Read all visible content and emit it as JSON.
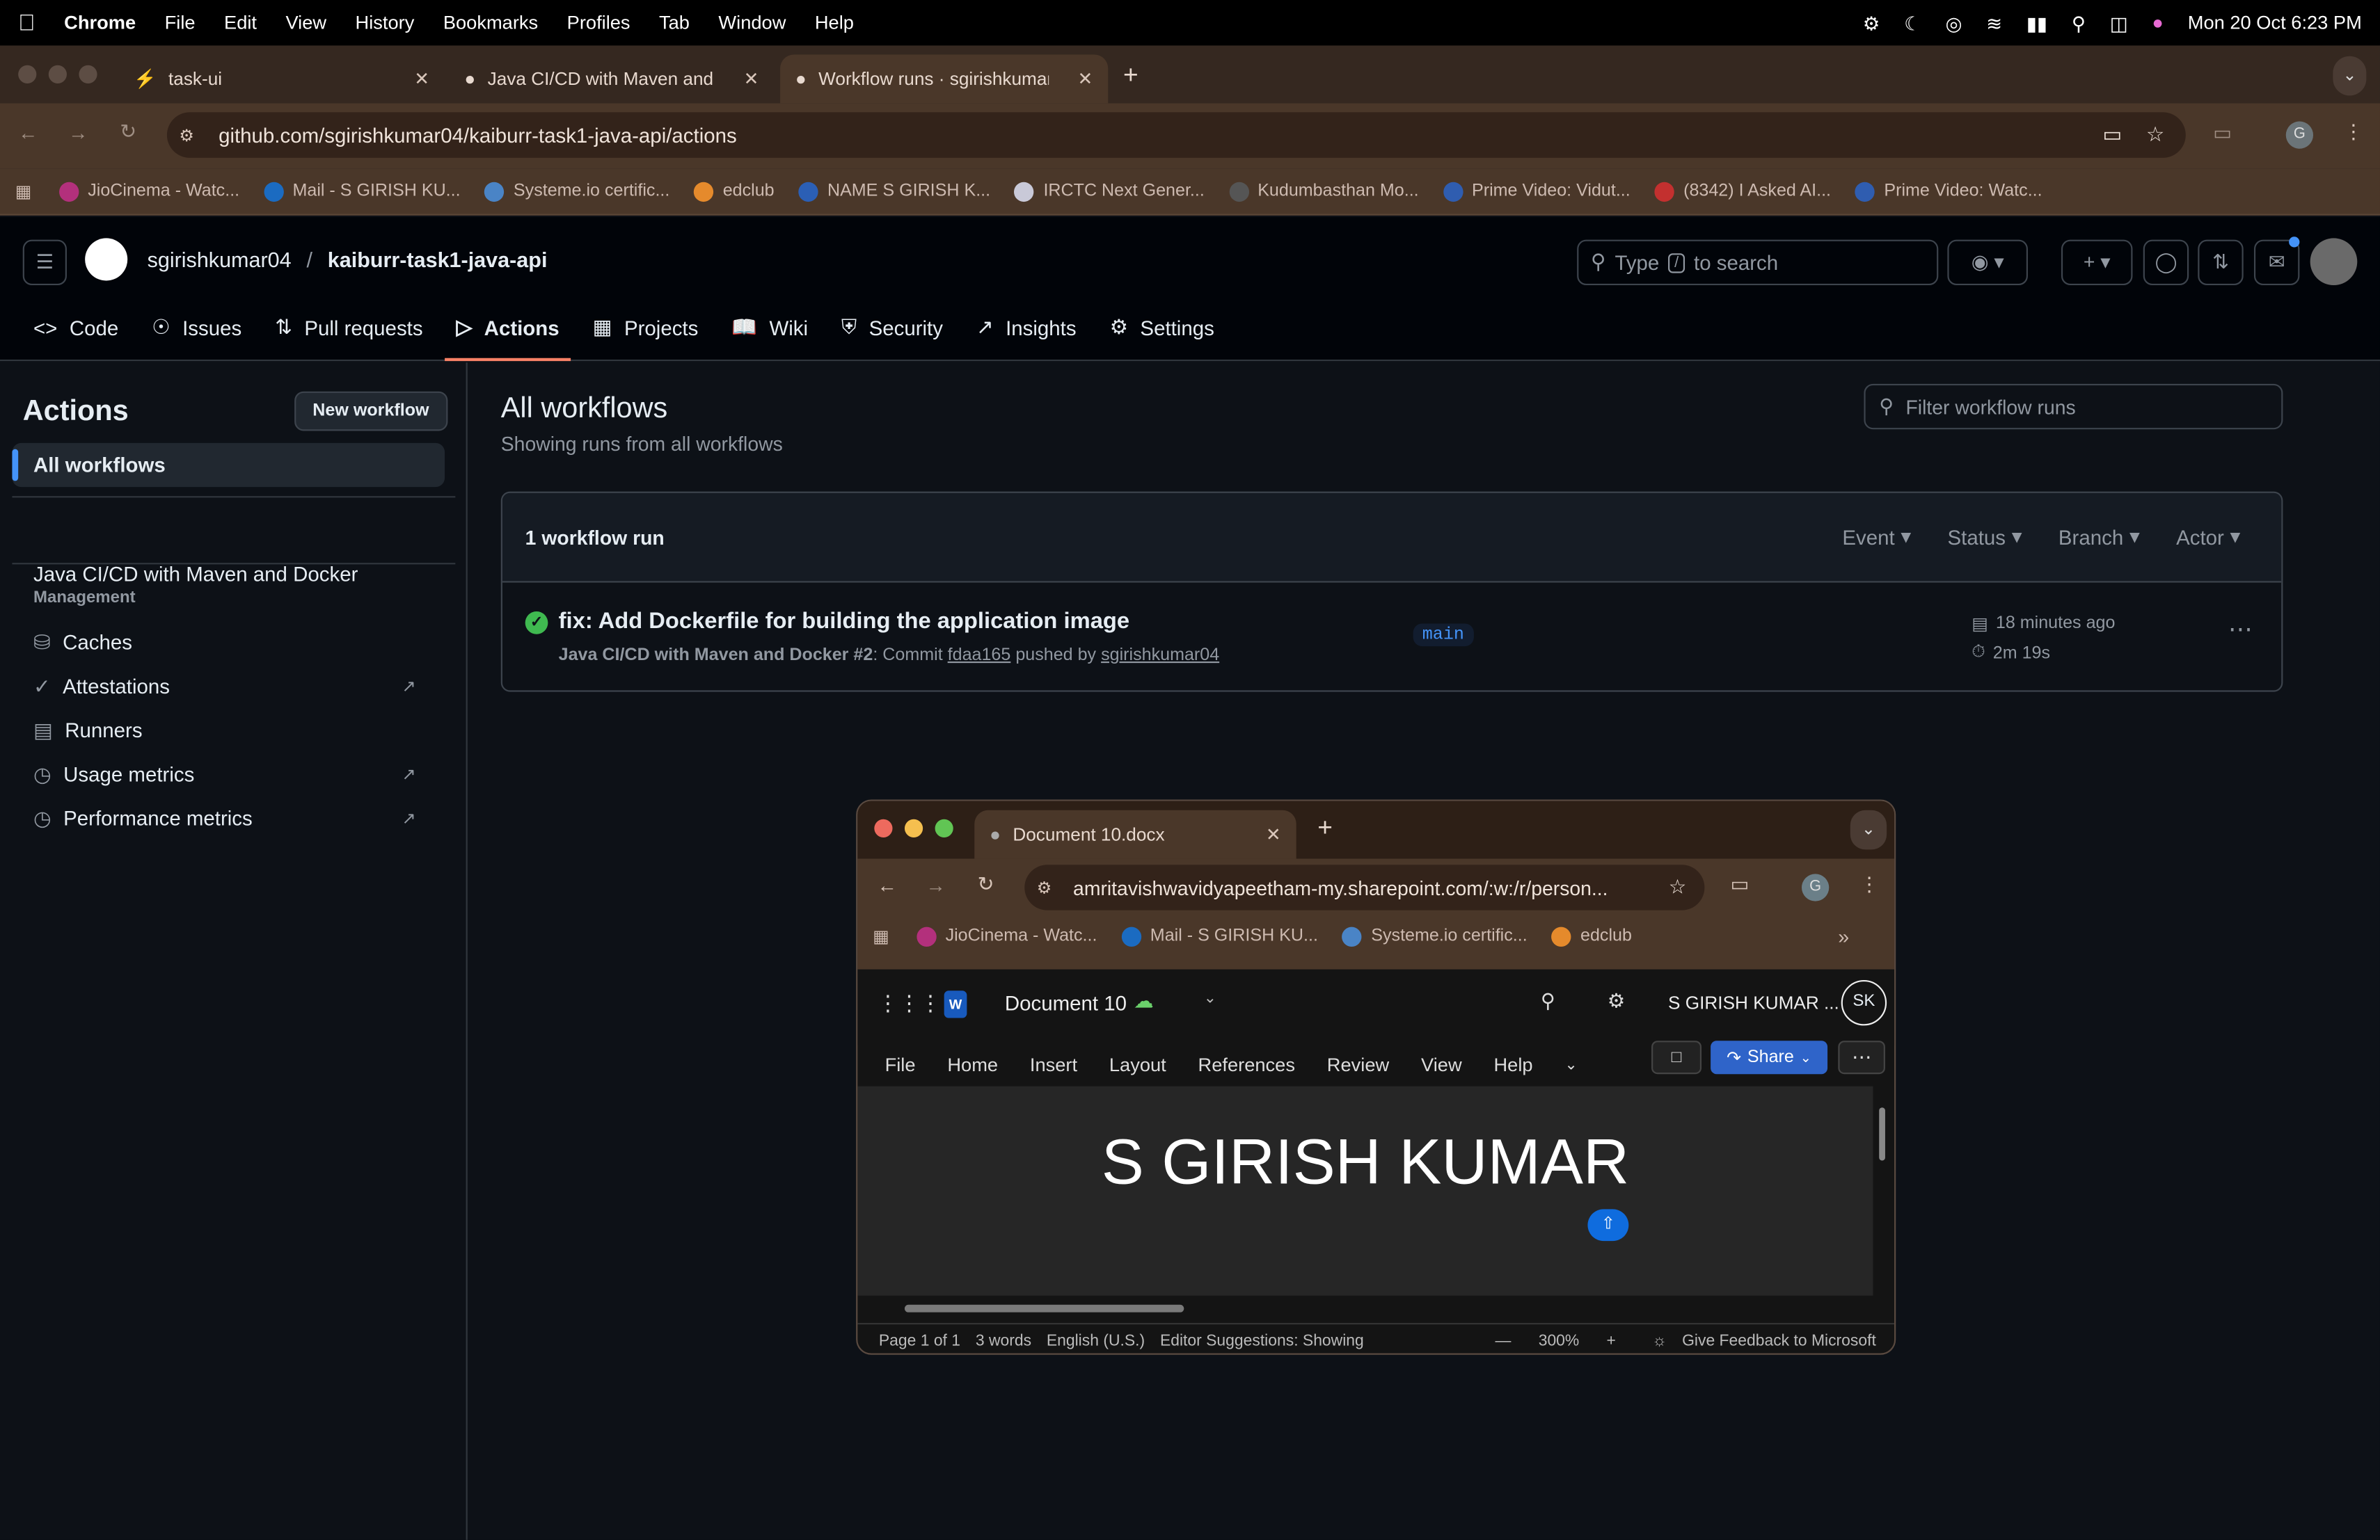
{
  "menubar": {
    "app": "Chrome",
    "items": [
      "File",
      "Edit",
      "View",
      "History",
      "Bookmarks",
      "Profiles",
      "Tab",
      "Window",
      "Help"
    ],
    "clock": "Mon 20 Oct  6:23 PM"
  },
  "tabs": [
    {
      "title": "task-ui"
    },
    {
      "title": "Java CI/CD with Maven and D"
    },
    {
      "title": "Workflow runs · sgirishkumar("
    }
  ],
  "address": "github.com/sgirishkumar04/kaiburr-task1-java-api/actions",
  "profile_initial": "G",
  "bookmarks": [
    {
      "label": "JioCinema - Watc...",
      "color": "#b3307c"
    },
    {
      "label": "Mail - S GIRISH KU...",
      "color": "#1b6bc1"
    },
    {
      "label": "Systeme.io certific...",
      "color": "#4a84c6"
    },
    {
      "label": "edclub",
      "color": "#e58a2c"
    },
    {
      "label": "NAME S GIRISH K...",
      "color": "#2b5fb5"
    },
    {
      "label": "IRCTC Next Gener...",
      "color": "#c9c9d8"
    },
    {
      "label": "Kudumbasthan Mo...",
      "color": "#555"
    },
    {
      "label": "Prime Video: Vidut...",
      "color": "#2f5db0"
    },
    {
      "label": "(8342) I Asked AI...",
      "color": "#c3302f"
    },
    {
      "label": "Prime Video: Watc...",
      "color": "#2f5db0"
    }
  ],
  "github": {
    "owner": "sgirishkumar04",
    "repo": "kaiburr-task1-java-api",
    "search_placeholder_pre": "Type",
    "search_key": "/",
    "search_placeholder_post": "to search",
    "nav": [
      "Code",
      "Issues",
      "Pull requests",
      "Actions",
      "Projects",
      "Wiki",
      "Security",
      "Insights",
      "Settings"
    ],
    "sidebar": {
      "title": "Actions",
      "new_workflow": "New workflow",
      "all_workflows": "All workflows",
      "workflows": [
        "Java CI/CD with Maven and Docker"
      ],
      "management_label": "Management",
      "management": [
        "Caches",
        "Attestations",
        "Runners",
        "Usage metrics",
        "Performance metrics"
      ]
    },
    "main": {
      "title": "All workflows",
      "subtitle": "Showing runs from all workflows",
      "filter_placeholder": "Filter workflow runs",
      "run_count": "1 workflow run",
      "filters": [
        "Event",
        "Status",
        "Branch",
        "Actor"
      ],
      "runs": [
        {
          "title": "fix: Add Dockerfile for building the application image",
          "workflow": "Java CI/CD with Maven and Docker",
          "run_number": "#2",
          "commit_prefix": ": Commit",
          "commit": "fdaa165",
          "pushed_by": "pushed by",
          "actor": "sgirishkumar04",
          "branch": "main",
          "time": "18 minutes ago",
          "duration": "2m 19s",
          "status": "success"
        }
      ]
    }
  },
  "word_window": {
    "tab_title": "Document 10.docx",
    "address": "amritavishwavidyapeetham-my.sharepoint.com/:w:/r/person...",
    "profile_initial": "G",
    "bookmarks": [
      "JioCinema - Watc...",
      "Mail - S GIRISH KU...",
      "Systeme.io certific...",
      "edclub"
    ],
    "doc_name": "Document 10",
    "user": "S GIRISH KUMAR ...",
    "user_initials": "SK",
    "menu": [
      "File",
      "Home",
      "Insert",
      "Layout",
      "References",
      "Review",
      "View",
      "Help"
    ],
    "share": "Share",
    "doc_text": "S GIRISH KUMAR",
    "status": {
      "page": "Page 1 of 1",
      "words": "3 words",
      "language": "English (U.S.)",
      "editor": "Editor Suggestions: Showing",
      "zoom": "300%",
      "feedback": "Give Feedback to Microsoft"
    }
  }
}
